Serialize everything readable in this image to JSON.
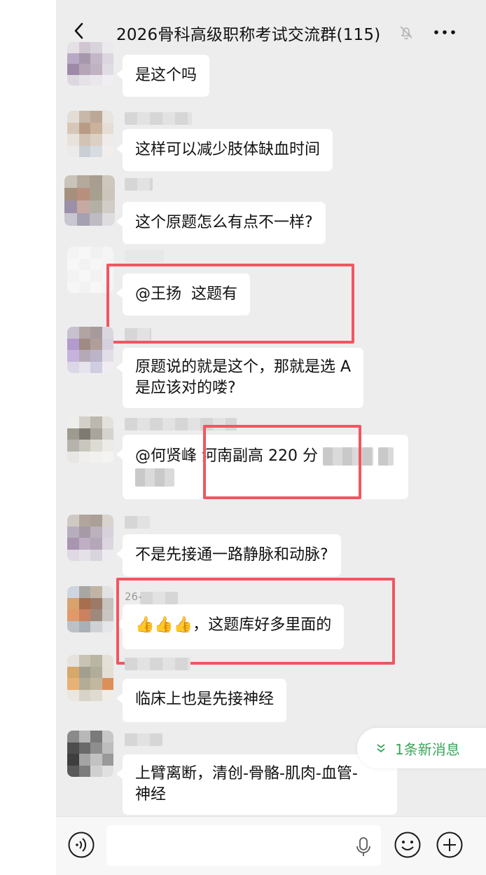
{
  "header": {
    "title": "2026骨科高级职称考试交流群(115)",
    "back_icon": "chevron-left-icon",
    "mute_icon": "bell-off-icon",
    "more_icon": "more-dots-icon"
  },
  "messages": [
    {
      "text": "是这个吗"
    },
    {
      "text": "这样可以减少肢体缺血时间"
    },
    {
      "text": "这个原题怎么有点不一样?"
    },
    {
      "mention": "@王扬",
      "text": "这题有"
    },
    {
      "line1": "原题说的就是这个，那就是选 A",
      "line2": "是应该对的喽?"
    },
    {
      "mention": "@何贤峰",
      "text": "河南副高 220 分"
    },
    {
      "text": "不是先接通一路静脉和动脉?"
    },
    {
      "name_fragment": "26-",
      "thumbs": "👍👍👍",
      "text": "，这题库好多里面的"
    },
    {
      "text": "临床上也是先接神经"
    },
    {
      "line1": "上臂离断，清创-骨骼-肌肉-血管-",
      "line2": "神经"
    }
  ],
  "new_messages": {
    "label": "1条新消息",
    "icon": "chevron-down-double-icon"
  },
  "input_bar": {
    "voice_icon": "voice-icon",
    "mic_icon": "mic-icon",
    "emoji_icon": "smile-icon",
    "plus_icon": "plus-icon",
    "placeholder": ""
  },
  "colors": {
    "chat_bg": "#ededed",
    "bubble_bg": "#ffffff",
    "highlight_box": "#f25561",
    "new_message_text": "#3aa45a"
  }
}
